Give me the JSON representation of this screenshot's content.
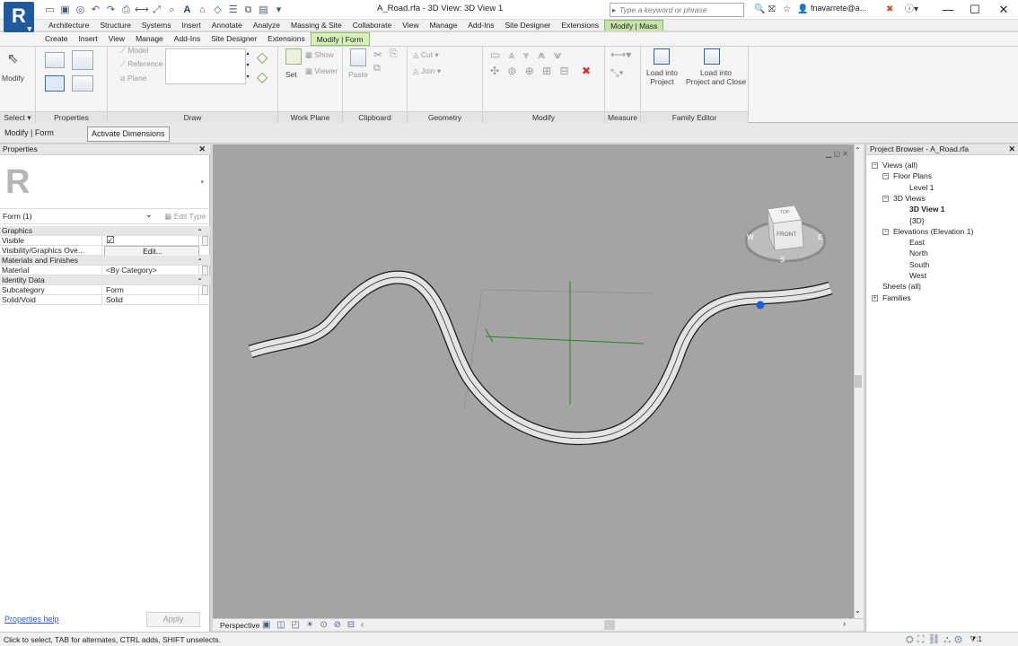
{
  "app": {
    "logo_letter": "R",
    "document_title": "A_Road.rfa - 3D View: 3D View 1",
    "search_placeholder": "Type a keyword or phrase",
    "user": "fnavarrete@a...",
    "window_controls": [
      "minimize-icon",
      "maximize-icon",
      "close-icon"
    ]
  },
  "ribbon_tabs_row1": [
    "Architecture",
    "Structure",
    "Systems",
    "Insert",
    "Annotate",
    "Analyze",
    "Massing & Site",
    "Collaborate",
    "View",
    "Manage",
    "Add-Ins",
    "Site Designer",
    "Extensions",
    "Modify | Mass"
  ],
  "ribbon_tabs_row2": [
    "Create",
    "Insert",
    "View",
    "Manage",
    "Add-Ins",
    "Site Designer",
    "Extensions",
    "Modify | Form"
  ],
  "ribbon": {
    "select": {
      "modify_label": "Modify",
      "panel": "Select ▾"
    },
    "properties": {
      "panel": "Properties"
    },
    "draw": {
      "model": "Model",
      "reference": "Reference",
      "plane": "Plane",
      "panel": "Draw"
    },
    "workplane": {
      "set": "Set",
      "show": "Show",
      "viewer": "Viewer",
      "panel": "Work Plane"
    },
    "clipboard": {
      "paste": "Paste",
      "panel": "Clipboard"
    },
    "geometry": {
      "cut": "Cut ▾",
      "join": "Join ▾",
      "panel": "Geometry"
    },
    "modify": {
      "panel": "Modify"
    },
    "measure": {
      "panel": "Measure"
    },
    "family_editor": {
      "load_project_1": "Load into",
      "load_project_2": "Project",
      "load_close_1": "Load into",
      "load_close_2": "Project and Close",
      "panel": "Family Editor"
    }
  },
  "mode": {
    "label": "Modify | Form",
    "activate_dimensions": "Activate Dimensions"
  },
  "properties": {
    "title": "Properties",
    "type_selector": "Form (1)",
    "edit_type": "Edit Type",
    "groups": [
      {
        "name": "Graphics",
        "rows": [
          {
            "name": "Visible",
            "value": "☑",
            "kind": "check"
          },
          {
            "name": "Visibility/Graphics Ove...",
            "value": "Edit...",
            "kind": "button"
          }
        ]
      },
      {
        "name": "Materials and Finishes",
        "rows": [
          {
            "name": "Material",
            "value": "<By Category>",
            "kind": "text"
          }
        ]
      },
      {
        "name": "Identity Data",
        "rows": [
          {
            "name": "Subcategory",
            "value": "Form",
            "kind": "text"
          },
          {
            "name": "Solid/Void",
            "value": "Solid",
            "kind": "text"
          }
        ]
      }
    ],
    "help": "Properties help",
    "apply": "Apply"
  },
  "view": {
    "viewcube": {
      "top": "TOP",
      "front": "FRONT",
      "w": "W",
      "s": "S",
      "e": "E"
    },
    "view_bar_label": "Perspective",
    "road_color": "#e3e3e3",
    "selection_color": "#1d5fd6",
    "workplane_color": "#1e8a1e"
  },
  "browser": {
    "title": "Project Browser - A_Road.rfa",
    "items": [
      {
        "label": "Views (all)",
        "level": 0
      },
      {
        "label": "Floor Plans",
        "level": 1
      },
      {
        "label": "Level 1",
        "level": 2
      },
      {
        "label": "3D Views",
        "level": 1
      },
      {
        "label": "3D View 1",
        "level": 2,
        "bold": true
      },
      {
        "label": "{3D}",
        "level": 2
      },
      {
        "label": "Elevations (Elevation 1)",
        "level": 1
      },
      {
        "label": "East",
        "level": 2
      },
      {
        "label": "North",
        "level": 2
      },
      {
        "label": "South",
        "level": 2
      },
      {
        "label": "West",
        "level": 2
      },
      {
        "label": "Sheets (all)",
        "level": 0
      },
      {
        "label": "Families",
        "level": 0
      }
    ]
  },
  "status": {
    "text": "Click to select, TAB for alternates, CTRL adds, SHIFT unselects.",
    "filter_count": ":1"
  }
}
